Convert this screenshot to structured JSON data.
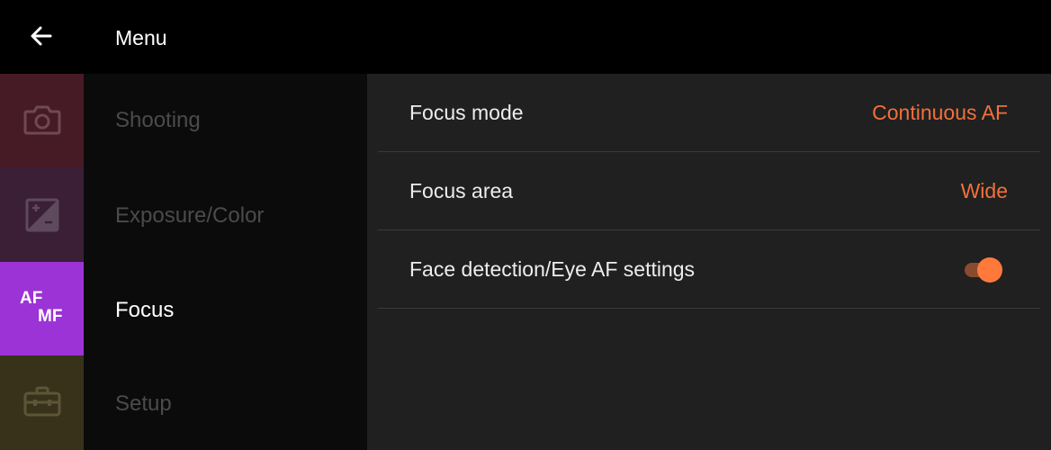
{
  "header": {
    "back_icon": "arrow-left-icon",
    "title": "Menu"
  },
  "categories": [
    {
      "icon": "camera-icon",
      "label": "Shooting",
      "active": false,
      "color": "#471b25"
    },
    {
      "icon": "exposure-compensation-icon",
      "label": "Exposure/Color",
      "active": false,
      "color": "#3a1f37"
    },
    {
      "icon": "af-mf-icon",
      "icon_text_top": "AF",
      "icon_text_bottom": "MF",
      "label": "Focus",
      "active": true,
      "color": "#9c33d6"
    },
    {
      "icon": "toolbox-icon",
      "label": "Setup",
      "active": false,
      "color": "#38321a"
    }
  ],
  "settings": [
    {
      "label": "Focus mode",
      "value": "Continuous AF"
    },
    {
      "label": "Focus area",
      "value": "Wide"
    },
    {
      "label": "Face detection/Eye AF settings",
      "toggle_on": true
    }
  ],
  "colors": {
    "accent": "#f2703a",
    "active_category": "#9c33d6"
  }
}
